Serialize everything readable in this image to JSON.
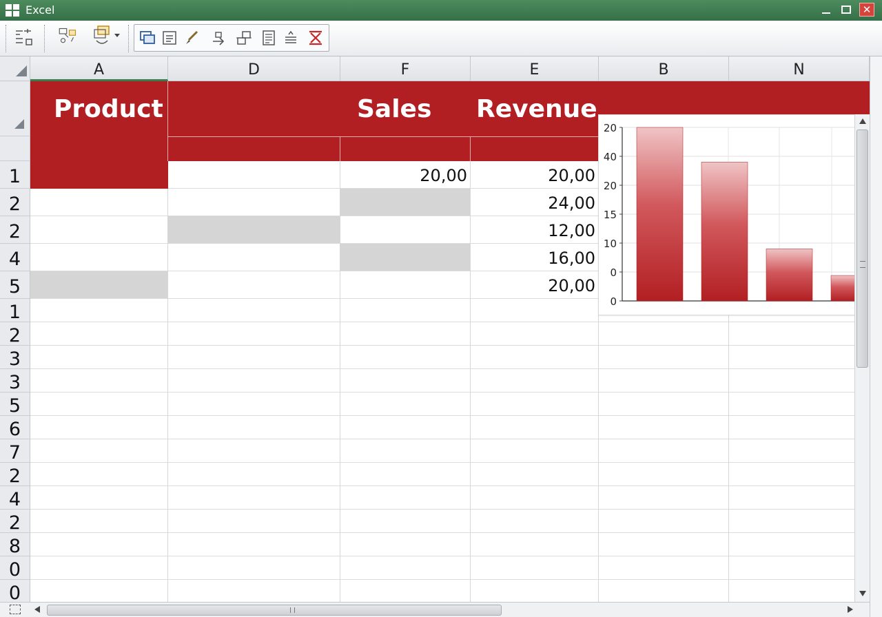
{
  "window": {
    "title": "Excel",
    "close_glyph": "✕"
  },
  "toolbar": {
    "icons": [
      "format-list-icon",
      "shapes-connect-icon",
      "shape-dropdown-icon",
      "bring-forward-icon",
      "text-box-icon",
      "brush-icon",
      "move-right-icon",
      "align-icon",
      "document-icon",
      "distribute-icon",
      "delete-red-icon"
    ]
  },
  "columns": [
    "A",
    "D",
    "F",
    "E",
    "B",
    "N"
  ],
  "row_headers": [
    "1",
    "2",
    "2",
    "4",
    "5",
    "1",
    "2",
    "3",
    "3",
    "5",
    "6",
    "7",
    "2",
    "4",
    "2",
    "8",
    "0",
    "0"
  ],
  "table_header": {
    "product": "Product",
    "sales": "Sales",
    "revenue": "Revenue"
  },
  "data_rows": [
    {
      "sales": "20,00",
      "revenue": "20,00"
    },
    {
      "sales": "",
      "revenue": "24,00"
    },
    {
      "sales": "",
      "revenue": "12,00"
    },
    {
      "sales": "",
      "revenue": "16,00"
    },
    {
      "sales": "",
      "revenue": "20,00"
    }
  ],
  "colors": {
    "accent_red": "#b21f22",
    "title_green": "#3f7d51",
    "selection_gray": "#d5d5d5"
  },
  "chart_data": {
    "type": "bar",
    "y_tick_labels": [
      "20",
      "40",
      "20",
      "15",
      "10",
      "0",
      "0"
    ],
    "values": [
      30,
      24,
      9,
      4.4
    ],
    "ylim": [
      0,
      30
    ],
    "grid": true,
    "legend": "none",
    "bar_color": "#b21f22"
  }
}
